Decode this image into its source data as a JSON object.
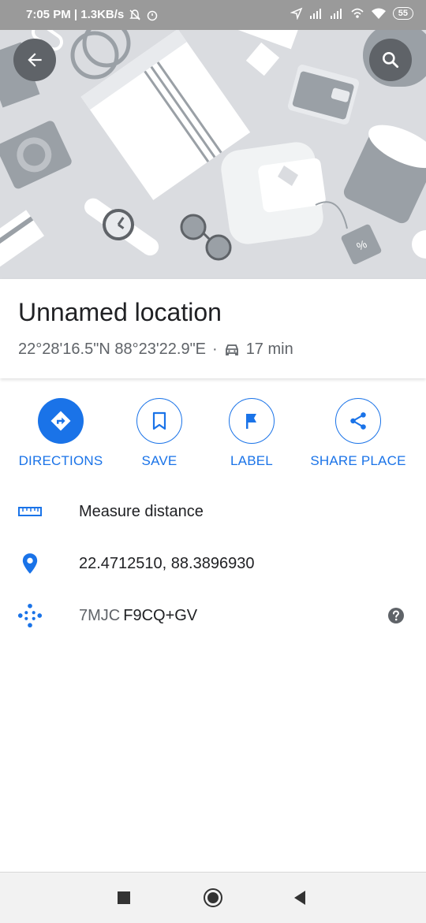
{
  "status_bar": {
    "time_speed": "7:05 PM | 1.3KB/s",
    "battery": "55"
  },
  "place": {
    "title": "Unnamed location",
    "coordinates_dms": "22°28'16.5\"N 88°23'22.9\"E",
    "separator": "·",
    "drive_time": "17 min"
  },
  "actions": [
    {
      "label": "DIRECTIONS",
      "icon": "directions-icon"
    },
    {
      "label": "SAVE",
      "icon": "bookmark-icon"
    },
    {
      "label": "LABEL",
      "icon": "flag-icon"
    },
    {
      "label": "SHARE PLACE",
      "icon": "share-icon"
    }
  ],
  "details": {
    "measure": "Measure distance",
    "decimal_coords": "22.4712510, 88.3896930",
    "plus_code_prefix": "7MJC",
    "plus_code": "F9CQ+GV"
  },
  "colors": {
    "accent": "#1a73e8",
    "text_primary": "#202124",
    "text_secondary": "#5f6368"
  }
}
